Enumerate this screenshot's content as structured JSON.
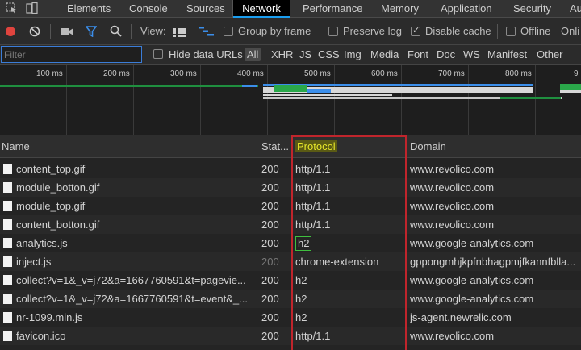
{
  "tabs": [
    {
      "label": "Elements",
      "active": false
    },
    {
      "label": "Console",
      "active": false
    },
    {
      "label": "Sources",
      "active": false
    },
    {
      "label": "Network",
      "active": true
    },
    {
      "label": "Performance",
      "active": false
    },
    {
      "label": "Memory",
      "active": false
    },
    {
      "label": "Application",
      "active": false
    },
    {
      "label": "Security",
      "active": false
    },
    {
      "label": "Au",
      "active": false
    }
  ],
  "toolbar": {
    "view_label": "View:",
    "group_by_frame": {
      "label": "Group by frame",
      "checked": false
    },
    "preserve_log": {
      "label": "Preserve log",
      "checked": false
    },
    "disable_cache": {
      "label": "Disable cache",
      "checked": true
    },
    "offline": {
      "label": "Offline",
      "checked": false
    },
    "online_cut": "Onli"
  },
  "filter": {
    "placeholder": "Filter",
    "hide_data_urls": {
      "label": "Hide data URLs",
      "checked": false
    },
    "types": [
      "All",
      "XHR",
      "JS",
      "CSS",
      "Img",
      "Media",
      "Font",
      "Doc",
      "WS",
      "Manifest",
      "Other"
    ]
  },
  "overview": {
    "ticks": [
      "100 ms",
      "200 ms",
      "300 ms",
      "400 ms",
      "500 ms",
      "600 ms",
      "700 ms",
      "800 ms",
      "9"
    ]
  },
  "table": {
    "columns": [
      "Name",
      "Stat...",
      "Protocol",
      "Domain"
    ],
    "rows": [
      {
        "name": "content_top.gif",
        "status": "200",
        "protocol": "http/1.1",
        "domain": "www.revolico.com"
      },
      {
        "name": "module_botton.gif",
        "status": "200",
        "protocol": "http/1.1",
        "domain": "www.revolico.com"
      },
      {
        "name": "module_top.gif",
        "status": "200",
        "protocol": "http/1.1",
        "domain": "www.revolico.com"
      },
      {
        "name": "content_botton.gif",
        "status": "200",
        "protocol": "http/1.1",
        "domain": "www.revolico.com"
      },
      {
        "name": "analytics.js",
        "status": "200",
        "protocol": "h2",
        "domain": "www.google-analytics.com",
        "highlight": true
      },
      {
        "name": "inject.js",
        "status": "200",
        "protocol": "chrome-extension",
        "domain": "gppongmhjkpfnbhagpmjfkannfblla...",
        "dim_status": true
      },
      {
        "name": "collect?v=1&_v=j72&a=1667760591&t=pagevie...",
        "status": "200",
        "protocol": "h2",
        "domain": "www.google-analytics.com"
      },
      {
        "name": "collect?v=1&_v=j72&a=1667760591&t=event&_...",
        "status": "200",
        "protocol": "h2",
        "domain": "www.google-analytics.com"
      },
      {
        "name": "nr-1099.min.js",
        "status": "200",
        "protocol": "h2",
        "domain": "js-agent.newrelic.com"
      },
      {
        "name": "favicon.ico",
        "status": "200",
        "protocol": "http/1.1",
        "domain": "www.revolico.com"
      }
    ]
  },
  "colors": {
    "accent_blue": "#1a9ef0",
    "record_red": "#e0443e",
    "highlight_red": "#c0252c",
    "highlight_green": "#3fbf3f",
    "protocol_header_bg": "#5a5a14",
    "protocol_header_text": "#e6e62a"
  }
}
